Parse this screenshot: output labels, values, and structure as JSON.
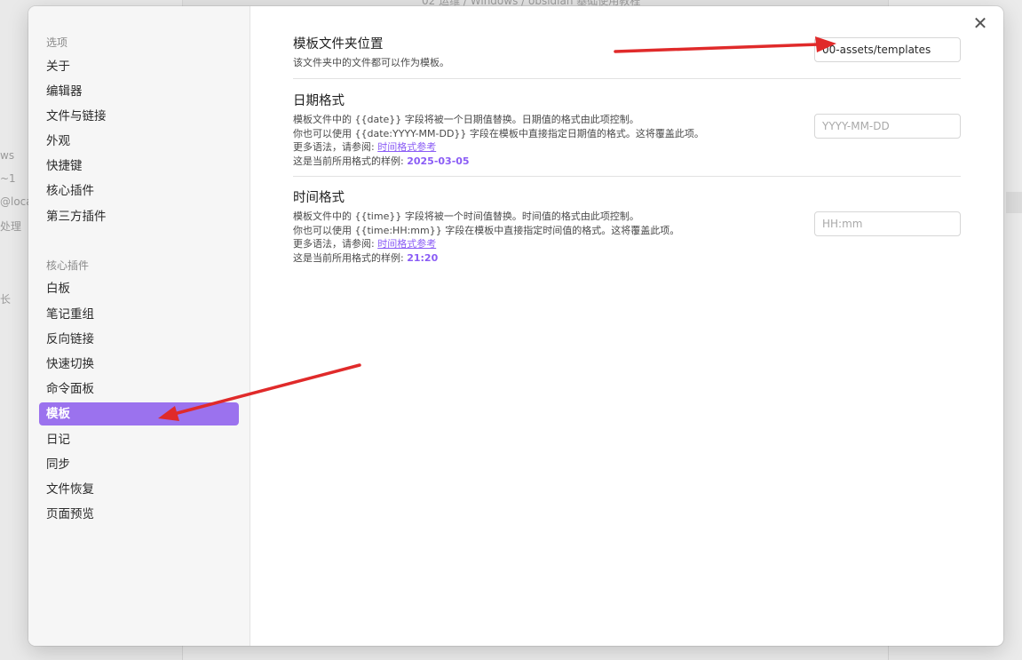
{
  "background": {
    "path": "02 运维  /  Windows  /  obsidian 基础使用教程",
    "fragments": [
      "ws",
      "~1",
      "@loca",
      "处理",
      "长"
    ]
  },
  "sidebar": {
    "options_heading": "选项",
    "options_items": [
      {
        "label": "关于"
      },
      {
        "label": "编辑器"
      },
      {
        "label": "文件与链接"
      },
      {
        "label": "外观"
      },
      {
        "label": "快捷键"
      },
      {
        "label": "核心插件"
      },
      {
        "label": "第三方插件"
      }
    ],
    "core_heading": "核心插件",
    "core_items": [
      {
        "label": "白板"
      },
      {
        "label": "笔记重组"
      },
      {
        "label": "反向链接"
      },
      {
        "label": "快速切换"
      },
      {
        "label": "命令面板"
      },
      {
        "label": "模板",
        "active": true
      },
      {
        "label": "日记"
      },
      {
        "label": "同步"
      },
      {
        "label": "文件恢复"
      },
      {
        "label": "页面预览"
      }
    ]
  },
  "close_label": "✕",
  "settings": {
    "folder": {
      "name": "模板文件夹位置",
      "desc": "该文件夹中的文件都可以作为模板。",
      "value": "00-assets/templates"
    },
    "date": {
      "name": "日期格式",
      "line1": "模板文件中的 {{date}} 字段将被一个日期值替换。日期值的格式由此项控制。",
      "line2": "你也可以使用 {{date:YYYY-MM-DD}} 字段在模板中直接指定日期值的格式。这将覆盖此项。",
      "more_prefix": "更多语法，请参阅: ",
      "more_link": "时间格式参考",
      "sample_prefix": "这是当前所用格式的样例: ",
      "sample_value": "2025-03-05",
      "placeholder": "YYYY-MM-DD"
    },
    "time": {
      "name": "时间格式",
      "line1": "模板文件中的 {{time}} 字段将被一个时间值替换。时间值的格式由此项控制。",
      "line2": "你也可以使用 {{time:HH:mm}} 字段在模板中直接指定时间值的格式。这将覆盖此项。",
      "more_prefix": "更多语法，请参阅: ",
      "more_link": "时间格式参考",
      "sample_prefix": "这是当前所用格式的样例: ",
      "sample_value": "21:20",
      "placeholder": "HH:mm"
    }
  },
  "colors": {
    "accent": "#9b72ee",
    "link": "#8a5cf5",
    "annotation_arrow": "#e02a2a"
  }
}
